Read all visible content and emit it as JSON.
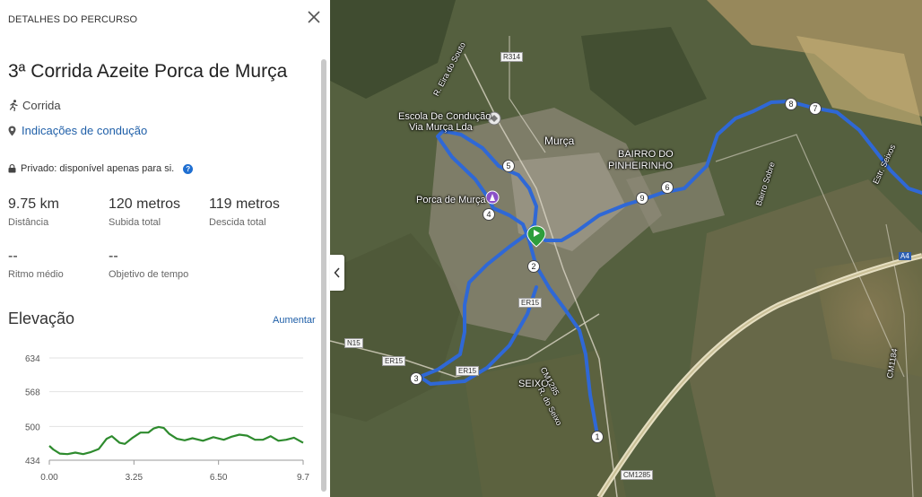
{
  "panel": {
    "header": "DETALHES DO PERCURSO",
    "route_title": "3ª Corrida Azeite Porca de Murça",
    "activity": "Corrida",
    "directions_link": "Indicações de condução",
    "privacy": "Privado: disponível apenas para si.",
    "stats": [
      {
        "value": "9.75 km",
        "label": "Distância"
      },
      {
        "value": "120 metros",
        "label": "Subida total"
      },
      {
        "value": "119 metros",
        "label": "Descida total"
      },
      {
        "value": "--",
        "label": "Ritmo médio"
      },
      {
        "value": "--",
        "label": "Objetivo de tempo"
      }
    ],
    "elevation_title": "Elevação",
    "elevation_link": "Aumentar"
  },
  "chart_data": {
    "type": "area",
    "title": "",
    "xlabel": "",
    "ylabel": "",
    "y_ticks": [
      "634",
      "568",
      "500",
      "434"
    ],
    "x_ticks": [
      "0.00",
      "3.25",
      "6.50",
      "9.7"
    ],
    "ylim": [
      434,
      634
    ],
    "xlim": [
      0,
      9.75
    ],
    "grid": true,
    "line_color": "#2e8b2e",
    "x": [
      0,
      0.15,
      0.4,
      0.7,
      1.0,
      1.3,
      1.6,
      1.9,
      2.2,
      2.4,
      2.7,
      2.9,
      3.2,
      3.5,
      3.8,
      4.0,
      4.2,
      4.4,
      4.6,
      4.9,
      5.2,
      5.5,
      5.9,
      6.3,
      6.7,
      7.0,
      7.3,
      7.6,
      7.9,
      8.2,
      8.5,
      8.8,
      9.1,
      9.4,
      9.75
    ],
    "y": [
      462,
      455,
      447,
      446,
      449,
      446,
      450,
      456,
      476,
      481,
      468,
      466,
      478,
      488,
      488,
      496,
      499,
      497,
      486,
      476,
      473,
      477,
      472,
      479,
      474,
      480,
      484,
      482,
      474,
      474,
      481,
      472,
      474,
      478,
      468
    ]
  },
  "map": {
    "labels": [
      {
        "text": "Escola De Condução"
      },
      {
        "text": "Via Murça Lda"
      },
      {
        "text": "Murça"
      },
      {
        "text": "BAIRRO DO"
      },
      {
        "text": "PINHEIRINHO"
      },
      {
        "text": "Porca de Murça"
      },
      {
        "text": "SEIXO"
      }
    ],
    "rotated_labels": [
      {
        "text": "R. Eira do Souto"
      },
      {
        "text": "Bairro Sobre"
      },
      {
        "text": "CM1285"
      },
      {
        "text": "R. do Seixo"
      },
      {
        "text": "Estr. Seixos"
      },
      {
        "text": "CM1184"
      }
    ],
    "road_badges": [
      {
        "text": "R314"
      },
      {
        "text": "ER15"
      },
      {
        "text": "N15"
      },
      {
        "text": "ER15"
      },
      {
        "text": "ER15"
      },
      {
        "text": "CM1285"
      }
    ],
    "motorway_badge": "A4",
    "waypoints": [
      "1",
      "2",
      "3",
      "4",
      "5",
      "6",
      "7",
      "8",
      "9"
    ],
    "route_color": "#2f68d6"
  }
}
